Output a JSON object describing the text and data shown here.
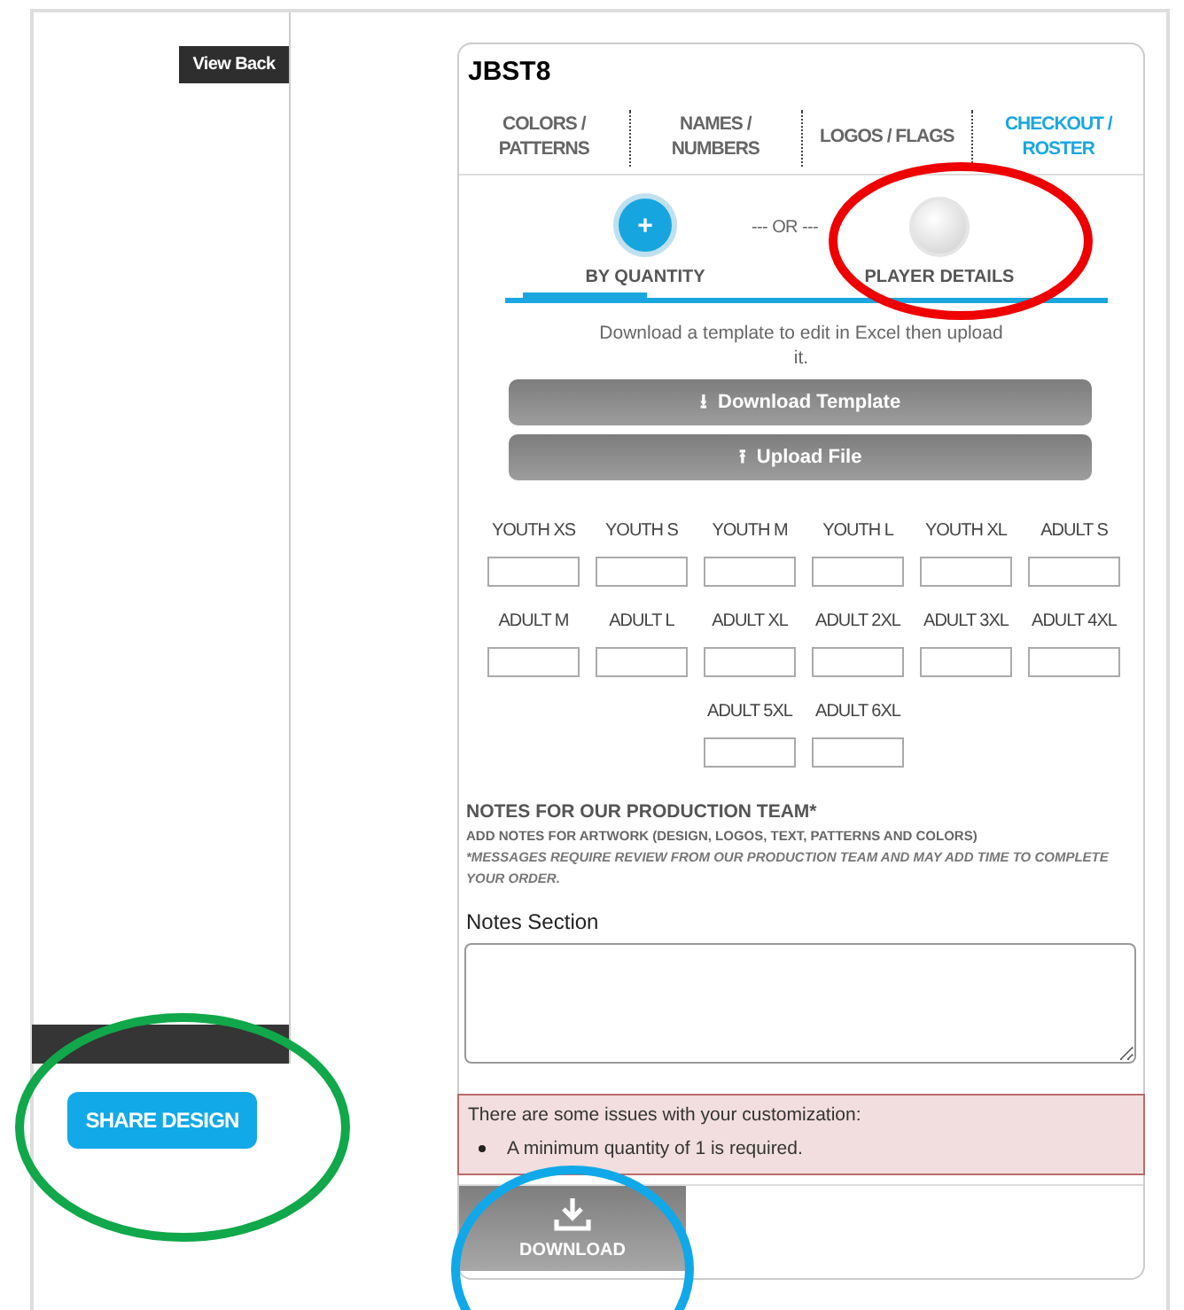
{
  "sidebar": {
    "view_back": "View Back",
    "share_button": "SHARE DESIGN"
  },
  "product": {
    "title": "JBST8"
  },
  "tabs": [
    {
      "label": "COLORS / PATTERNS",
      "selected": false
    },
    {
      "label": "NAMES / NUMBERS",
      "selected": false
    },
    {
      "label": "LOGOS / FLAGS",
      "selected": false
    },
    {
      "label": "CHECKOUT / ROSTER",
      "selected": true
    }
  ],
  "modes": [
    {
      "label": "BY QUANTITY",
      "icon": "+",
      "selected": true
    },
    {
      "label": "PLAYER DETAILS",
      "selected": false
    }
  ],
  "separator": "--- OR ---",
  "instructions": "Download a template to edit in Excel then upload it.",
  "buttons": [
    {
      "label": "Download Template",
      "icon": "⭳"
    },
    {
      "label": "Upload File",
      "icon": "⭱"
    }
  ],
  "size_rows": [
    [
      "YOUTH XS",
      "YOUTH S",
      "YOUTH M",
      "YOUTH L",
      "YOUTH XL",
      "ADULT S"
    ],
    [
      "ADULT M",
      "ADULT L",
      "ADULT XL",
      "ADULT 2XL",
      "ADULT 3XL",
      "ADULT 4XL"
    ],
    [
      "ADULT 5XL",
      "ADULT 6XL"
    ]
  ],
  "notes": {
    "heading": "NOTES FOR OUR PRODUCTION TEAM*",
    "subheading": "ADD NOTES FOR ARTWORK (DESIGN, LOGOS, TEXT, PATTERNS AND COLORS)",
    "disclaimer": "*MESSAGES REQUIRE REVIEW FROM OUR PRODUCTION TEAM AND MAY ADD TIME TO COMPLETE YOUR ORDER.",
    "label": "Notes Section"
  },
  "alert": {
    "title": "There are some issues with your customization:",
    "items": [
      "A minimum quantity of 1 is required."
    ]
  },
  "download_button": "DOWNLOAD",
  "annotations": [
    {
      "color": "#ee0000"
    },
    {
      "color": "#10a84a"
    },
    {
      "color": "#10a8e8"
    }
  ]
}
